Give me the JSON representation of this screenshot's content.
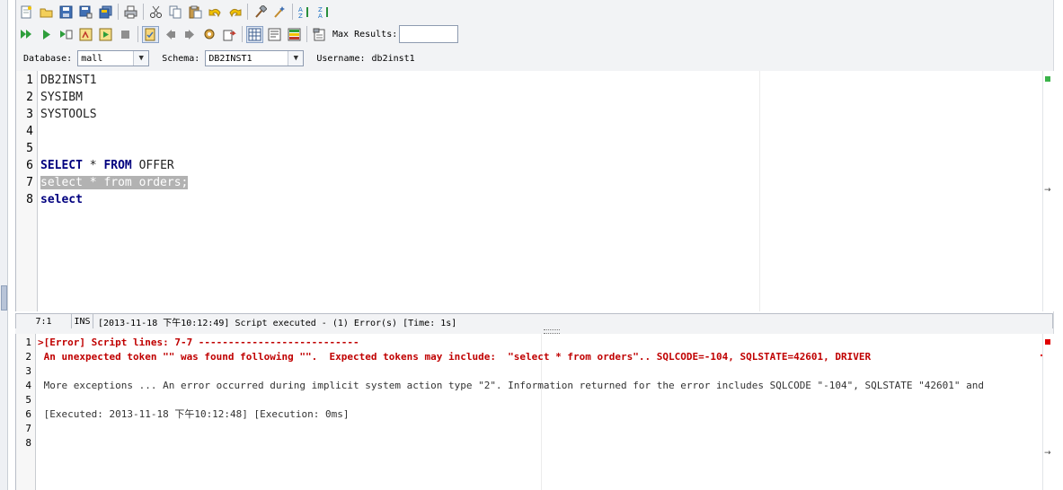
{
  "toolbar": {
    "max_results_label": "Max Results:",
    "max_results_value": ""
  },
  "connection": {
    "database_label": "Database:",
    "database_value": "mall",
    "schema_label": "Schema:",
    "schema_value": "DB2INST1",
    "username_label": "Username:",
    "username_value": "db2inst1"
  },
  "editor": {
    "lines": [
      {
        "n": "1",
        "text": "DB2INST1"
      },
      {
        "n": "2",
        "text": "SYSIBM"
      },
      {
        "n": "3",
        "text": "SYSTOOLS"
      },
      {
        "n": "4",
        "text": ""
      },
      {
        "n": "5",
        "text": ""
      },
      {
        "n": "6",
        "kw1": "SELECT",
        "mid": " * ",
        "kw2": "FROM",
        "rest": " OFFER"
      },
      {
        "n": "7",
        "text": "select * from orders;"
      },
      {
        "n": "8",
        "kw1": "select"
      }
    ]
  },
  "status": {
    "position": "7:1",
    "mode": "INS",
    "message": "[2013-11-18 下午10:12:49] Script executed - (1) Error(s) [Time: 1s]"
  },
  "output": {
    "lines": [
      {
        "n": "1",
        "text": ">[Error] Script lines: 7-7 ---------------------------"
      },
      {
        "n": "2",
        "text": " An unexpected token \"\" was found following \"\".  Expected tokens may include:  \"select * from orders\".. SQLCODE=-104, SQLSTATE=42601, DRIVER"
      },
      {
        "n": "3",
        "text": ""
      },
      {
        "n": "4",
        "text": " More exceptions ... An error occurred during implicit system action type \"2\". Information returned for the error includes SQLCODE \"-104\", SQLSTATE \"42601\" and"
      },
      {
        "n": "5",
        "text": ""
      },
      {
        "n": "6",
        "text": " [Executed: 2013-11-18 下午10:12:48] [Execution: 0ms]"
      },
      {
        "n": "7",
        "text": ""
      },
      {
        "n": "8",
        "text": ""
      }
    ]
  },
  "icons": [
    "new-file-icon",
    "open-icon",
    "save-icon",
    "save-as-icon",
    "save-all-icon",
    "print-icon",
    "cut-icon",
    "copy-icon",
    "paste-icon",
    "undo-icon",
    "redo-icon",
    "hammer-icon",
    "format-icon",
    "sort-asc-icon",
    "sort-desc-icon",
    "run-all-icon",
    "run-icon",
    "run-step-icon",
    "explain-icon",
    "run-batch-icon",
    "stop-icon",
    "commit-icon",
    "previous-icon",
    "next-icon",
    "tools-icon",
    "export-icon",
    "grid-mode-icon",
    "text-mode-icon",
    "record-mode-icon",
    "properties-icon"
  ],
  "colors": {
    "keyword": "#00007f",
    "error": "#c00000",
    "selection": "#b2b2b2",
    "ok_marker": "#3bb34a"
  }
}
